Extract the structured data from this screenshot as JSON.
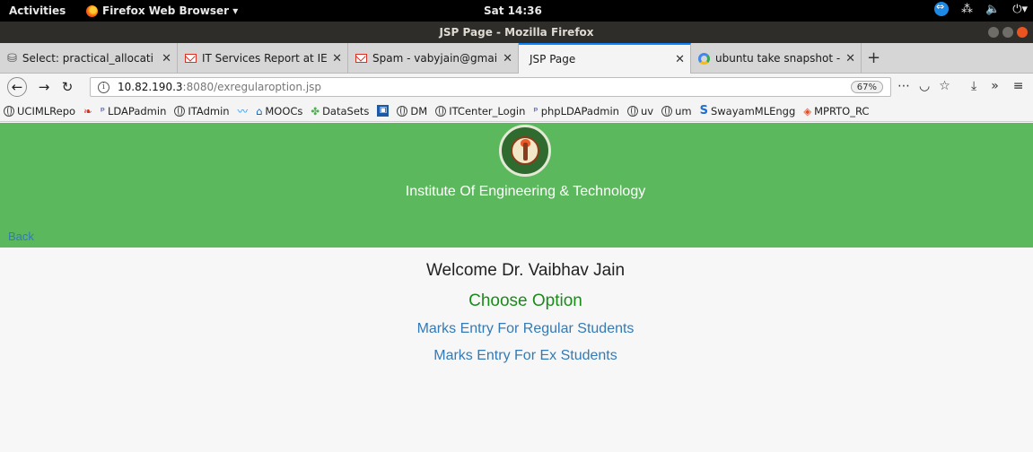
{
  "system_bar": {
    "activities": "Activities",
    "app_name": "Firefox Web Browser ▾",
    "clock": "Sat 14:36"
  },
  "window": {
    "title": "JSP Page - Mozilla Firefox"
  },
  "tabs": [
    {
      "label": "Select: practical_allocati",
      "icon": "database-icon"
    },
    {
      "label": "IT Services Report at IET-",
      "icon": "gmail-icon"
    },
    {
      "label": "Spam - vabyjain@gmail.c",
      "icon": "gmail-icon"
    },
    {
      "label": "JSP Page",
      "icon": "none",
      "active": true
    },
    {
      "label": "ubuntu take snapshot - G",
      "icon": "google-icon"
    }
  ],
  "navbar": {
    "url_host": "10.82.190.3",
    "url_rest": ":8080/exregularoption.jsp",
    "zoom": "67%"
  },
  "bookmarks": [
    {
      "label": "UCIMLRepo",
      "icon": "globe-icon"
    },
    {
      "label": "",
      "icon": "red-feather-icon"
    },
    {
      "label": "LDAPadmin",
      "icon": "phpldapadmin-icon"
    },
    {
      "label": "ITAdmin",
      "icon": "globe-icon"
    },
    {
      "label": "",
      "icon": "wave-icon"
    },
    {
      "label": "MOOCs",
      "icon": "mooc-icon"
    },
    {
      "label": "DataSets",
      "icon": "datasets-icon"
    },
    {
      "label": "",
      "icon": "dm-box-icon"
    },
    {
      "label": "DM",
      "icon": "globe-icon"
    },
    {
      "label": "ITCenter_Login",
      "icon": "globe-icon"
    },
    {
      "label": "phpLDAPadmin",
      "icon": "phpldapadmin-icon"
    },
    {
      "label": "uv",
      "icon": "globe-icon"
    },
    {
      "label": "um",
      "icon": "globe-icon"
    },
    {
      "label": "SwayamMLEngg",
      "icon": "swayam-icon"
    },
    {
      "label": "MPRTO_RC",
      "icon": "mprto-icon"
    }
  ],
  "page": {
    "institute_name": "Institute Of Engineering & Technology",
    "back_link": "Back",
    "welcome": "Welcome Dr. Vaibhav Jain",
    "choose_option": "Choose Option",
    "option_regular": "Marks Entry For Regular Students",
    "option_ex": "Marks Entry For Ex Students",
    "colors": {
      "banner": "#5cb85c",
      "link": "#337ab7",
      "choose": "#1a8c1a"
    }
  }
}
